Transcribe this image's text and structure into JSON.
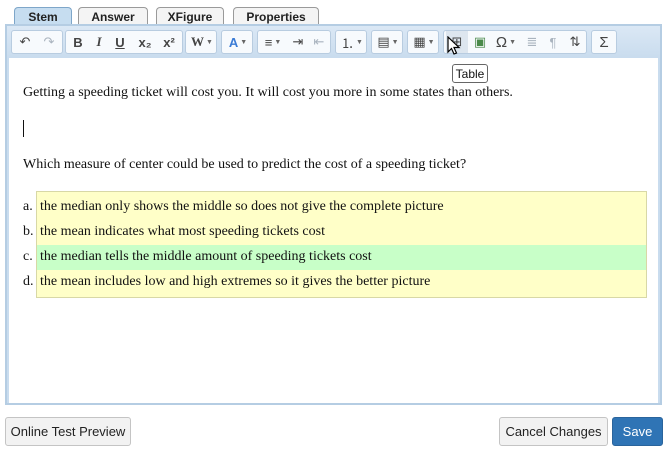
{
  "tabs": [
    {
      "label": "Stem",
      "active": true
    },
    {
      "label": "Answer",
      "active": false
    },
    {
      "label": "XFigure",
      "active": false
    },
    {
      "label": "Properties",
      "active": false
    }
  ],
  "toolbar": {
    "buttons": [
      {
        "name": "undo",
        "glyph": "↶"
      },
      {
        "name": "redo",
        "glyph": "↷"
      },
      {
        "name": "bold",
        "glyph": "B"
      },
      {
        "name": "italic",
        "glyph": "I"
      },
      {
        "name": "underline",
        "glyph": "U"
      },
      {
        "name": "subscript",
        "glyph": "x₂"
      },
      {
        "name": "superscript",
        "glyph": "x²"
      },
      {
        "name": "word",
        "glyph": "W"
      },
      {
        "name": "font-color",
        "glyph": "A"
      },
      {
        "name": "align-left",
        "glyph": "≡"
      },
      {
        "name": "indent",
        "glyph": "⇥"
      },
      {
        "name": "outdent",
        "glyph": "⇤"
      },
      {
        "name": "numbered-list",
        "glyph": "⒈"
      },
      {
        "name": "block",
        "glyph": "▤"
      },
      {
        "name": "insert",
        "glyph": "▦"
      },
      {
        "name": "table",
        "glyph": "⊞"
      },
      {
        "name": "image",
        "glyph": "▣"
      },
      {
        "name": "special-character",
        "glyph": "Ω"
      },
      {
        "name": "paragraph-style",
        "glyph": "≣"
      },
      {
        "name": "pilcrow",
        "glyph": "¶"
      },
      {
        "name": "strikethrough-ruler",
        "glyph": "⇅"
      },
      {
        "name": "sigma",
        "glyph": "Σ"
      }
    ]
  },
  "content": {
    "intro": "Getting a speeding ticket will cost you. It will cost you more in some states than others.",
    "question": "Which measure of center could be used to predict the cost of a speeding ticket?",
    "choices": [
      {
        "letter": "a.",
        "text": "the median only shows the middle so does not give the complete picture",
        "selected": false
      },
      {
        "letter": "b.",
        "text": "the mean indicates what most speeding tickets cost",
        "selected": false
      },
      {
        "letter": "c.",
        "text": "the median tells the middle amount of speeding tickets cost",
        "selected": true
      },
      {
        "letter": "d.",
        "text": "the mean includes low and high extremes so it gives the better picture",
        "selected": false
      }
    ]
  },
  "tooltip": "Table",
  "footer": {
    "preview_label": "Online Test Preview",
    "cancel_label": "Cancel Changes",
    "save_label": "Save"
  },
  "colors": {
    "accent": "#2f74b5",
    "choice_background": "#ffffc8",
    "selected_choice": "#c8ffc8"
  }
}
